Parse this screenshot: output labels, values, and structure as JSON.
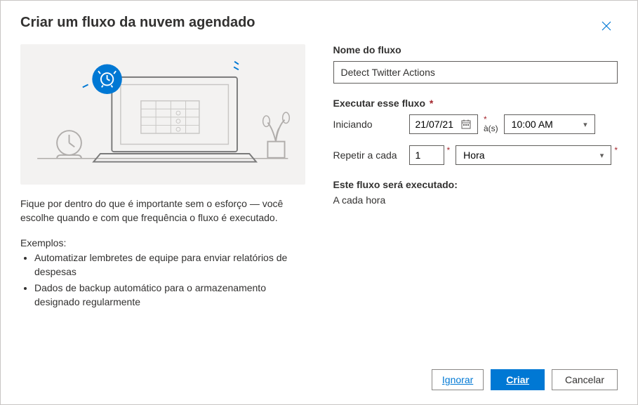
{
  "header": {
    "title": "Criar um fluxo da nuvem agendado"
  },
  "left": {
    "description": "Fique por dentro do que é importante sem o esforço — você escolhe quando e com que frequência o fluxo é executado.",
    "examples_title": "Exemplos:",
    "examples": [
      "Automatizar lembretes de equipe para enviar relatórios de despesas",
      "Dados de backup automático para o armazenamento designado regularmente"
    ]
  },
  "form": {
    "flow_name_label": "Nome do fluxo",
    "flow_name_value": "Detect Twitter Actions",
    "run_label": "Executar esse fluxo",
    "starting_label": "Iniciando",
    "start_date": "21/07/21",
    "at_label": "à(s)",
    "start_time": "10:00 AM",
    "repeat_label": "Repetir a cada",
    "repeat_value": "1",
    "repeat_unit": "Hora",
    "summary_title": "Este fluxo será executado:",
    "summary_text": "A cada hora"
  },
  "footer": {
    "skip": "Ignorar",
    "create": "Criar",
    "cancel": "Cancelar"
  }
}
